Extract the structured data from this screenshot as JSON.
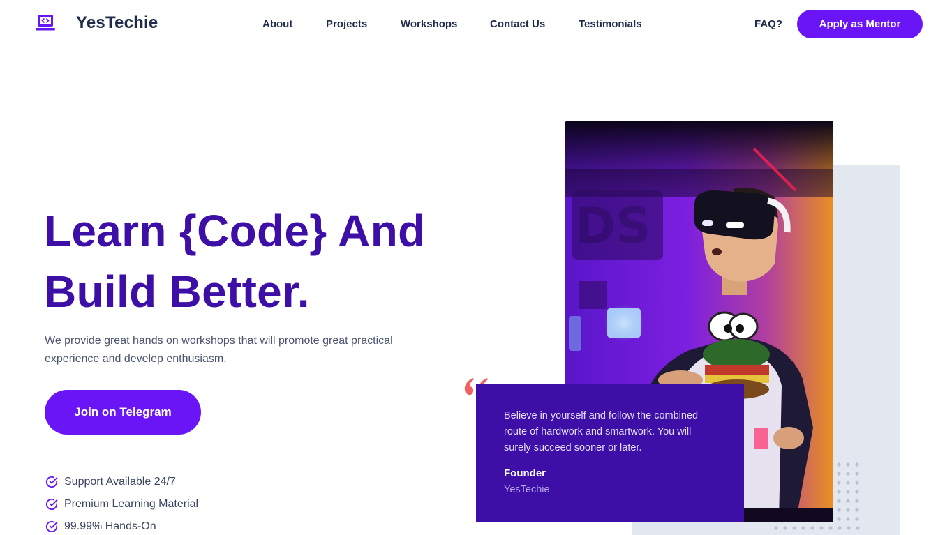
{
  "brand": {
    "name": "YesTechie",
    "accent": "#6915f5",
    "heading_color": "#3d0fa6",
    "logo_icon": "laptop-code-icon"
  },
  "nav": {
    "links": [
      "About",
      "Projects",
      "Workshops",
      "Contact Us",
      "Testimonials"
    ],
    "faq": "FAQ?",
    "cta": "Apply as Mentor"
  },
  "hero": {
    "title_line1": "Learn {Code} And",
    "title_line2": "Build Better.",
    "description": "We provide great hands on workshops that will promote great practical experience and develep enthusiasm.",
    "cta": "Join on Telegram",
    "features": [
      "Support Available 24/7",
      "Premium Learning Material",
      "99.99% Hands-On"
    ],
    "feature_icon": "check-circle-icon",
    "image_icon": "vr-headset-person-photo"
  },
  "testimonial": {
    "quote": "Believe in yourself and follow the combined route of hardwork and smartwork. You will surely succeed sooner or later.",
    "role": "Founder",
    "org": "YesTechie",
    "quote_icon": "quote-mark-icon",
    "quote_color": "#f06261"
  }
}
